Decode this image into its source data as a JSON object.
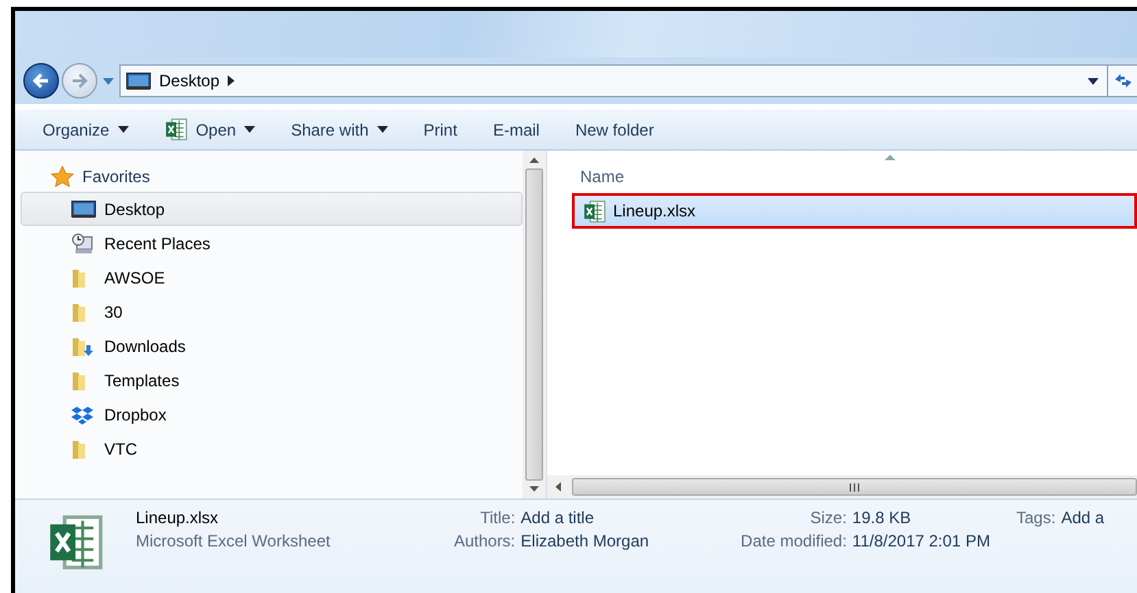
{
  "address": {
    "path": "Desktop"
  },
  "toolbar": [
    {
      "label": "Organize",
      "kind": "plain",
      "dropdown": true
    },
    {
      "label": "Open",
      "kind": "excel",
      "dropdown": true
    },
    {
      "label": "Share with",
      "kind": "plain",
      "dropdown": true
    },
    {
      "label": "Print",
      "kind": "plain",
      "dropdown": false
    },
    {
      "label": "E-mail",
      "kind": "plain",
      "dropdown": false
    },
    {
      "label": "New folder",
      "kind": "plain",
      "dropdown": false
    }
  ],
  "navigation": {
    "header": "Favorites",
    "items": [
      {
        "label": "Desktop",
        "kind": "desktop",
        "selected": true
      },
      {
        "label": "Recent Places",
        "kind": "recent",
        "selected": false
      },
      {
        "label": "AWSOE",
        "kind": "folder",
        "selected": false
      },
      {
        "label": "30",
        "kind": "folder",
        "selected": false
      },
      {
        "label": "Downloads",
        "kind": "downloads",
        "selected": false
      },
      {
        "label": "Templates",
        "kind": "folder",
        "selected": false
      },
      {
        "label": "Dropbox",
        "kind": "dropbox",
        "selected": false
      },
      {
        "label": "VTC",
        "kind": "folder",
        "selected": false
      }
    ]
  },
  "file_list": {
    "columns": [
      "Name"
    ],
    "files": [
      {
        "name": "Lineup.xlsx",
        "selected": true,
        "highlighted": true
      }
    ]
  },
  "details": {
    "name": "Lineup.xlsx",
    "type": "Microsoft Excel Worksheet",
    "columns": [
      [
        {
          "label": "Title:",
          "value": "Add a title"
        },
        {
          "label": "Authors:",
          "value": "Elizabeth Morgan"
        }
      ],
      [
        {
          "label": "Size:",
          "value": "19.8 KB"
        },
        {
          "label": "Date modified:",
          "value": "11/8/2017 2:01 PM"
        }
      ],
      [
        {
          "label": "Tags:",
          "value": "Add a"
        }
      ]
    ]
  }
}
